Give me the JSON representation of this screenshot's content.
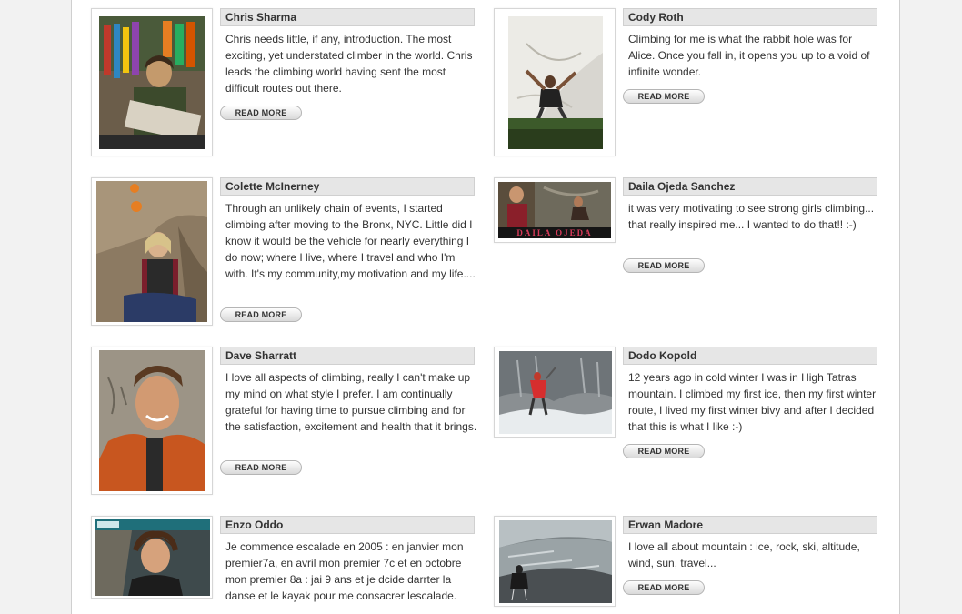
{
  "climbers": [
    {
      "name": "Chris Sharma",
      "bio": "Chris needs little, if any, introduction. The most exciting, yet understated climber in the world. Chris leads the climbing world having sent the most difficult routes out there.",
      "read_more": "READ MORE",
      "photo_icon": "climber-portrait-shop"
    },
    {
      "name": "Cody Roth",
      "bio": "Climbing for me is what the rabbit hole was for Alice. Once you fall in, it opens you up to a void of infinite wonder.",
      "read_more": "READ MORE",
      "photo_icon": "climber-on-rock-face"
    },
    {
      "name": "Colette McInerney",
      "bio": "Through an unlikely chain of events, I started climbing after moving to the Bronx, NYC. Little did I know it would be the vehicle for nearly everything I do now; where I live, where I travel and who I'm with. It's my community,my motivation and my life....",
      "read_more": "READ MORE",
      "photo_icon": "climber-juggling-in-cave"
    },
    {
      "name": "Daila Ojeda Sanchez",
      "bio": "it was very motivating to see strong girls climbing... that really inspired me... I wanted to do that!! :-)",
      "read_more": "READ MORE",
      "photo_icon": "climber-banner",
      "photo_caption": "DAILA OJEDA"
    },
    {
      "name": "Dave Sharratt",
      "bio": "I love all aspects of climbing, really I can't make up my mind on what style I prefer. I am continually grateful for having time to pursue climbing and for the satisfaction, excitement and health that it brings.",
      "read_more": "READ MORE",
      "photo_icon": "climber-smiling-portrait"
    },
    {
      "name": "Dodo Kopold",
      "bio": "12 years ago in cold winter I was in High Tatras mountain. I climbed my first ice, then my first winter route, I lived my first winter bivy and after I decided that this is what I like :-)",
      "read_more": "READ MORE",
      "photo_icon": "climber-winter-mountain"
    },
    {
      "name": "Enzo Oddo",
      "bio": "Je commence escalade en 2005 : en janvier mon premier7a, en avril mon premier 7c et en octobre mon premier 8a : jai 9 ans et je dcide darrter la danse et le kayak pour me consacrer lescalade.",
      "read_more": "READ MORE",
      "photo_icon": "climber-magazine-portrait"
    },
    {
      "name": "Erwan Madore",
      "bio": "I love all about mountain : ice, rock, ski, altitude, wind, sun, travel...",
      "read_more": "READ MORE",
      "photo_icon": "climber-ice-slope"
    }
  ]
}
